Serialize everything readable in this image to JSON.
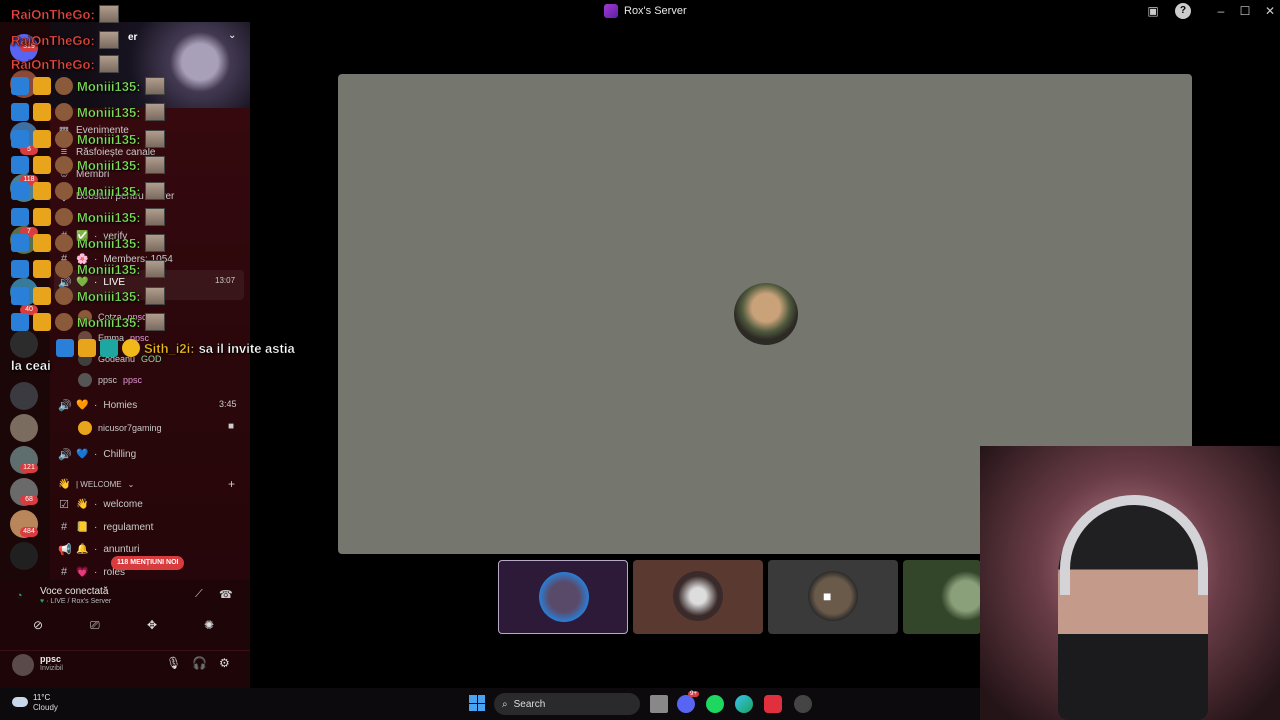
{
  "window": {
    "title": "Rox's Server"
  },
  "chat_overlay": [
    {
      "user": "RaiOnTheGo:",
      "color": "#e8453c"
    },
    {
      "user": "RaiOnTheGo:",
      "color": "#e8453c"
    },
    {
      "user": "RaiOnTheGo:",
      "color": "#e8453c"
    },
    {
      "user": "Moniii135:",
      "color": "#7ee05a"
    },
    {
      "user": "Moniii135:",
      "color": "#7ee05a"
    },
    {
      "user": "Moniii135:",
      "color": "#7ee05a"
    },
    {
      "user": "Moniii135:",
      "color": "#7ee05a"
    },
    {
      "user": "Moniii135:",
      "color": "#7ee05a"
    },
    {
      "user": "Moniii135:",
      "color": "#7ee05a"
    },
    {
      "user": "Moniii135:",
      "color": "#7ee05a"
    },
    {
      "user": "Moniii135:",
      "color": "#7ee05a"
    },
    {
      "user": "Moniii135:",
      "color": "#7ee05a"
    },
    {
      "user": "Moniii135:",
      "color": "#7ee05a"
    }
  ],
  "last_message": {
    "user": "Sith_i2i:",
    "user_color": "#f0b818",
    "text": "sa il invite astia",
    "continuation": "la ceai"
  },
  "sidebar": {
    "banner_partial": "er",
    "items_partial": [
      "Evenimente",
      "Răsfoiește canale",
      "Membri",
      "Boosturi pentru server"
    ],
    "channels": [
      {
        "icon": "#",
        "emoji": "✅",
        "name": "verify"
      },
      {
        "icon": "#",
        "emoji": "🌸",
        "name": "Members: 1054"
      },
      {
        "icon": "🔊",
        "emoji": "💚",
        "name": "LIVE",
        "time": "13:07"
      }
    ],
    "live_members": [
      "Cotza",
      "Emma",
      "Godeanu",
      "ppsc"
    ],
    "live_member_tags": {
      "Cotza": "ppsc",
      "Emma": "ppsc",
      "Godeanu": "GOD",
      "ppsc": "ppsc"
    },
    "homies": {
      "emoji": "🧡",
      "name": "Homies",
      "time": "3:45",
      "member": "nicusor7gaming"
    },
    "chilling": {
      "emoji": "💙",
      "name": "Chilling"
    },
    "category": "| WELCOME",
    "category_emoji": "👋",
    "welcome_channels": [
      {
        "emoji": "👋",
        "name": "welcome"
      },
      {
        "emoji": "📒",
        "name": "regulament"
      },
      {
        "emoji": "🔔",
        "name": "anunturi"
      },
      {
        "emoji": "💗",
        "name": "roles"
      }
    ],
    "mentions_badge": "118 MENȚIUNI NOI",
    "rail_badges": [
      "319",
      "5",
      "118",
      "7",
      "40",
      "121",
      "68",
      "484"
    ]
  },
  "voice": {
    "status": "Voce conectată",
    "location": "LIVE / Rox's Server"
  },
  "user": {
    "name": "ppsc",
    "status": "Invizibil"
  },
  "taskbar": {
    "weather_temp": "11°C",
    "weather_desc": "Cloudy",
    "search_label": "Search",
    "discord_badge": "9+"
  },
  "colors": {
    "accent_red": "#d83c3e",
    "voice_green": "#23a55a",
    "stage_bg": "#75776e"
  }
}
